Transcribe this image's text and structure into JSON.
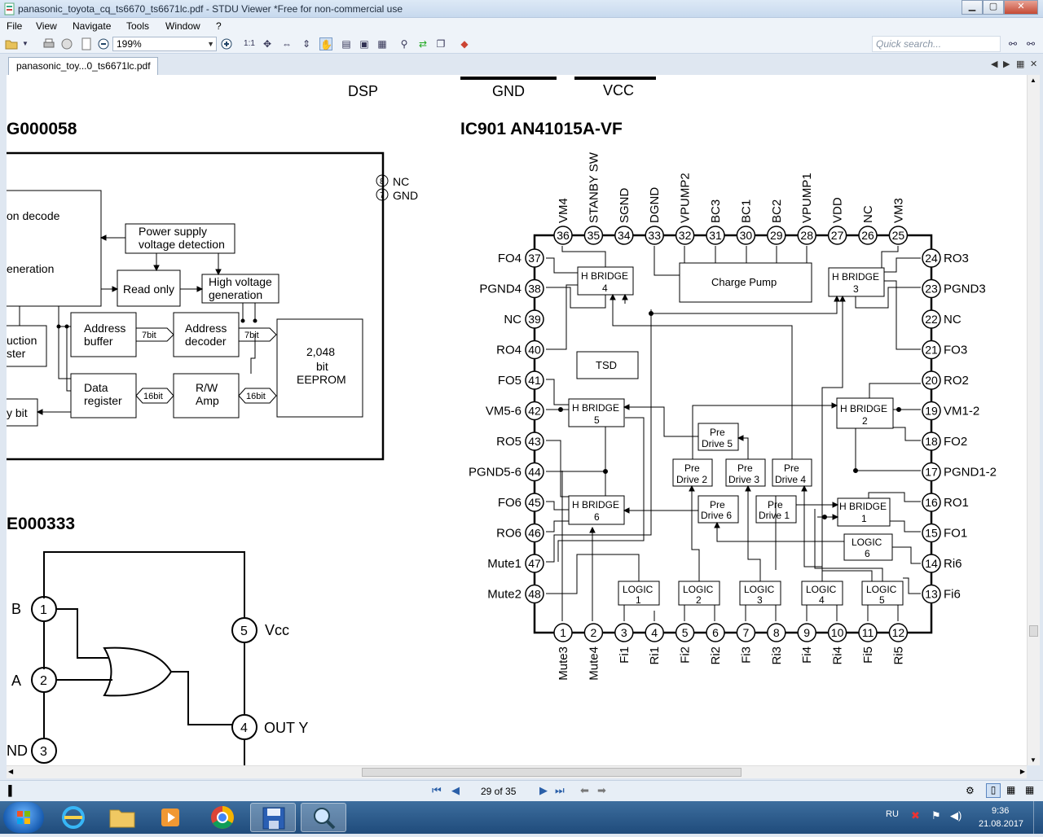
{
  "window": {
    "title": "panasonic_toyota_cq_ts6670_ts6671lc.pdf - STDU Viewer *Free for non-commercial use",
    "minimize": "▁",
    "maximize": "▢",
    "close": "✕"
  },
  "menu": [
    "File",
    "View",
    "Navigate",
    "Tools",
    "Window",
    "?"
  ],
  "toolbar": {
    "zoom_value": "199%",
    "actual_size": "1:1",
    "search_placeholder": "Quick search..."
  },
  "tab": {
    "label": "panasonic_toy...0_ts6671lc.pdf"
  },
  "statusbar": {
    "page_text": "29 of 35"
  },
  "taskbar": {
    "language": "RU",
    "time": "9:36",
    "date": "21.08.2017"
  },
  "schematic": {
    "top_labels": [
      "DSP",
      "GND",
      "VCC"
    ],
    "left_section_title": "G000058",
    "right_section_title": "IC901  AN41015A-VF",
    "lower_section_title": "E000333",
    "eeprom_pins": [
      {
        "num": "8",
        "label": "NC"
      },
      {
        "num": "7",
        "label": "GND"
      }
    ],
    "eeprom_blocks": {
      "decode": "on decode",
      "generation": "eneration",
      "power": [
        "Power supply",
        "voltage detection"
      ],
      "read_only": "Read only",
      "high_voltage": [
        "High voltage",
        "generation"
      ],
      "instruction": [
        "uction",
        "ster"
      ],
      "address_buffer": [
        "Address",
        "buffer"
      ],
      "address_decoder": [
        "Address",
        "decoder"
      ],
      "eeprom": [
        "2,048",
        "bit",
        "EEPROM"
      ],
      "data_register": [
        "Data",
        "register"
      ],
      "rw_amp": [
        "R/W",
        "Amp"
      ],
      "y_bit": "y bit",
      "bus_7bit": "7bit",
      "bus_16bit": "16bit"
    },
    "gate": {
      "pin1": "1",
      "pin2": "2",
      "pin3": "3",
      "pin4": "4",
      "pin5": "5",
      "label_b": "B",
      "label_a": "A",
      "label_gnd": "ND",
      "label_vcc": "Vcc",
      "label_out": "OUT Y"
    },
    "ic_top_pins": [
      {
        "num": "36",
        "label": "VM4"
      },
      {
        "num": "35",
        "label": "STANBY SW"
      },
      {
        "num": "34",
        "label": "SGND"
      },
      {
        "num": "33",
        "label": "DGND"
      },
      {
        "num": "32",
        "label": "VPUMP2"
      },
      {
        "num": "31",
        "label": "BC3"
      },
      {
        "num": "30",
        "label": "BC1"
      },
      {
        "num": "29",
        "label": "BC2"
      },
      {
        "num": "28",
        "label": "VPUMP1"
      },
      {
        "num": "27",
        "label": "VDD"
      },
      {
        "num": "26",
        "label": "NC"
      },
      {
        "num": "25",
        "label": "VM3"
      }
    ],
    "ic_bottom_pins": [
      {
        "num": "1",
        "label": "Mute3"
      },
      {
        "num": "2",
        "label": "Mute4"
      },
      {
        "num": "3",
        "label": "Fi1"
      },
      {
        "num": "4",
        "label": "Ri1"
      },
      {
        "num": "5",
        "label": "Fi2"
      },
      {
        "num": "6",
        "label": "Ri2"
      },
      {
        "num": "7",
        "label": "Fi3"
      },
      {
        "num": "8",
        "label": "Ri3"
      },
      {
        "num": "9",
        "label": "Fi4"
      },
      {
        "num": "10",
        "label": "Ri4"
      },
      {
        "num": "11",
        "label": "Fi5"
      },
      {
        "num": "12",
        "label": "Ri5"
      }
    ],
    "ic_left_pins": [
      {
        "num": "37",
        "label": "FO4"
      },
      {
        "num": "38",
        "label": "PGND4"
      },
      {
        "num": "39",
        "label": "NC"
      },
      {
        "num": "40",
        "label": "RO4"
      },
      {
        "num": "41",
        "label": "FO5"
      },
      {
        "num": "42",
        "label": "VM5-6"
      },
      {
        "num": "43",
        "label": "RO5"
      },
      {
        "num": "44",
        "label": "PGND5-6"
      },
      {
        "num": "45",
        "label": "FO6"
      },
      {
        "num": "46",
        "label": "RO6"
      },
      {
        "num": "47",
        "label": "Mute1"
      },
      {
        "num": "48",
        "label": "Mute2"
      }
    ],
    "ic_right_pins": [
      {
        "num": "24",
        "label": "RO3"
      },
      {
        "num": "23",
        "label": "PGND3"
      },
      {
        "num": "22",
        "label": "NC"
      },
      {
        "num": "21",
        "label": "FO3"
      },
      {
        "num": "20",
        "label": "RO2"
      },
      {
        "num": "19",
        "label": "VM1-2"
      },
      {
        "num": "18",
        "label": "FO2"
      },
      {
        "num": "17",
        "label": "PGND1-2"
      },
      {
        "num": "16",
        "label": "RO1"
      },
      {
        "num": "15",
        "label": "FO1"
      },
      {
        "num": "14",
        "label": "Ri6"
      },
      {
        "num": "13",
        "label": "Fi6"
      }
    ],
    "ic_blocks": {
      "hb4": [
        "H BRIDGE",
        "4"
      ],
      "hb3": [
        "H BRIDGE",
        "3"
      ],
      "hb5": [
        "H BRIDGE",
        "5"
      ],
      "hb2": [
        "H BRIDGE",
        "2"
      ],
      "hb6": [
        "H BRIDGE",
        "6"
      ],
      "hb1": [
        "H BRIDGE",
        "1"
      ],
      "charge_pump": "Charge Pump",
      "tsd": "TSD",
      "pd5": [
        "Pre",
        "Drive 5"
      ],
      "pd2": [
        "Pre",
        "Drive 2"
      ],
      "pd3": [
        "Pre",
        "Drive 3"
      ],
      "pd4": [
        "Pre",
        "Drive 4"
      ],
      "pd6": [
        "Pre",
        "Drive 6"
      ],
      "pd1": [
        "Pre",
        "Drive 1"
      ],
      "logic6": [
        "LOGIC",
        "6"
      ],
      "logic1": [
        "LOGIC",
        "1"
      ],
      "logic2": [
        "LOGIC",
        "2"
      ],
      "logic3": [
        "LOGIC",
        "3"
      ],
      "logic4": [
        "LOGIC",
        "4"
      ],
      "logic5": [
        "LOGIC",
        "5"
      ]
    }
  }
}
